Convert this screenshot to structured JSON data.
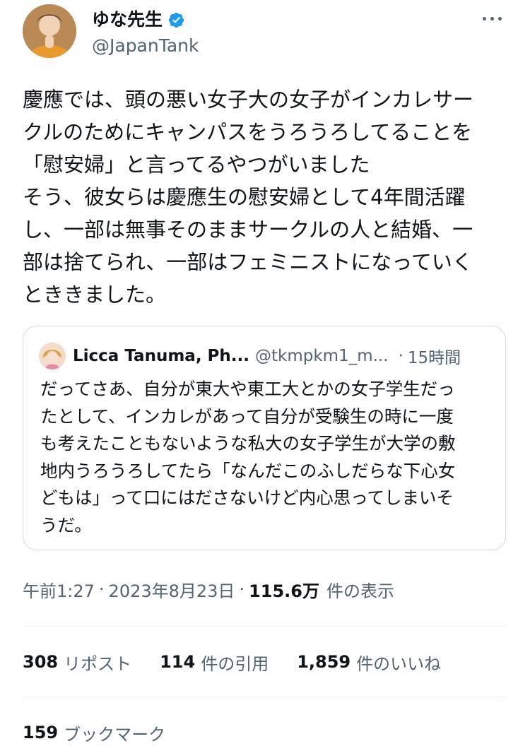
{
  "tweet": {
    "author": {
      "display_name": "ゆな先生",
      "handle": "@JapanTank",
      "verified": true,
      "avatar_icon": "user-avatar"
    },
    "more_icon": "more-horizontal-icon",
    "text_lines": [
      "慶應では、頭の悪い女子大の女子がインカレサー",
      "クルのためにキャンパスをうろうろしてることを",
      "「慰安婦」と言ってるやつがいました",
      "そう、彼女らは慶應生の慰安婦として4年間活躍",
      "し、一部は無事そのままサークルの人と結婚、一",
      "部は捨てられ、一部はフェミニストになっていく",
      "とききました。"
    ],
    "quote": {
      "author_name": "Licca Tanuma, Ph...",
      "author_handle": "@tkmpkm1_m...",
      "separator": "·",
      "time": "15時間",
      "text_lines": [
        "だってさあ、自分が東大や東工大とかの女子学生だっ",
        "たとして、インカレがあって自分が受験生の時に一度",
        "も考えたこともないような私大の女子学生が大学の敷",
        "地内うろうろしてたら「なんだこのふしだらな下心女",
        "どもは」って口にはださないけど内心思ってしまいそ",
        "うだ。"
      ]
    },
    "meta": {
      "time": "午前1:27",
      "dot": "·",
      "date": "2023年8月23日",
      "views_count": "115.6万",
      "views_label": "件の表示"
    },
    "stats": {
      "reposts_count": "308",
      "reposts_label": "リポスト",
      "quotes_count": "114",
      "quotes_label": "件の引用",
      "likes_count": "1,859",
      "likes_label": "件のいいね",
      "bookmarks_count": "159",
      "bookmarks_label": "ブックマーク"
    }
  },
  "colors": {
    "text_primary": "#0f1419",
    "text_secondary": "#536471",
    "verified_blue": "#1d9bf0",
    "border": "#cfd9de",
    "divider": "#eff3f4"
  }
}
